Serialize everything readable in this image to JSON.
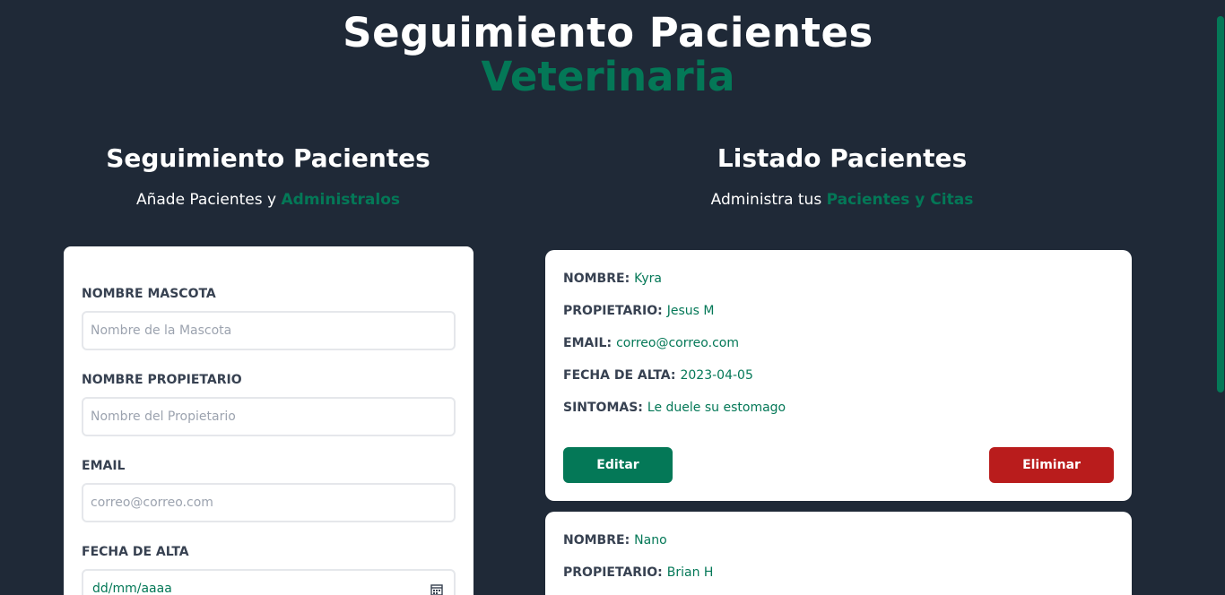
{
  "header": {
    "title_line1": "Seguimiento Pacientes",
    "title_line2": "Veterinaria"
  },
  "form_section": {
    "heading": "Seguimiento Pacientes",
    "subtitle_prefix": "Añade Pacientes y ",
    "subtitle_accent": "Administralos",
    "fields": {
      "pet_name": {
        "label": "Nombre Mascota",
        "placeholder": "Nombre de la Mascota"
      },
      "owner_name": {
        "label": "Nombre Propietario",
        "placeholder": "Nombre del Propietario"
      },
      "email": {
        "label": "Email",
        "placeholder": "correo@correo.com"
      },
      "date": {
        "label": "Fecha de Alta",
        "placeholder": "dd/mm/aaaa",
        "icon": "calendar-icon"
      }
    }
  },
  "list_section": {
    "heading": "Listado Pacientes",
    "subtitle_prefix": "Administra tus ",
    "subtitle_accent": "Pacientes y Citas"
  },
  "labels": {
    "name": "Nombre:",
    "owner": "Propietario:",
    "email": "Email:",
    "date": "Fecha de Alta:",
    "symptoms": "Sintomas:",
    "edit": "Editar",
    "delete": "Eliminar"
  },
  "patients": [
    {
      "name": "Kyra",
      "owner": "Jesus M",
      "email": "correo@correo.com",
      "date": "2023-04-05",
      "symptoms": "Le duele su estomago"
    },
    {
      "name": "Nano",
      "owner": "Brian H"
    }
  ],
  "colors": {
    "background": "#1f2937",
    "accent": "#047857",
    "danger": "#b91c1c",
    "card": "#ffffff"
  }
}
